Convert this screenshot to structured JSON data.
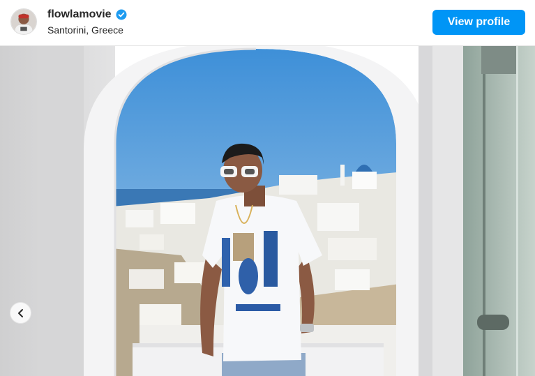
{
  "post": {
    "username": "flowlamovie",
    "verified": true,
    "location": "Santorini, Greece",
    "view_profile_label": "View profile"
  },
  "carousel": {
    "prev_icon": "chevron-left-icon"
  },
  "colors": {
    "button_blue": "#0095f6",
    "verified_blue": "#1d9bf0",
    "sky_blue": "#4d9fe0",
    "wall_white": "#e9e9ea"
  }
}
